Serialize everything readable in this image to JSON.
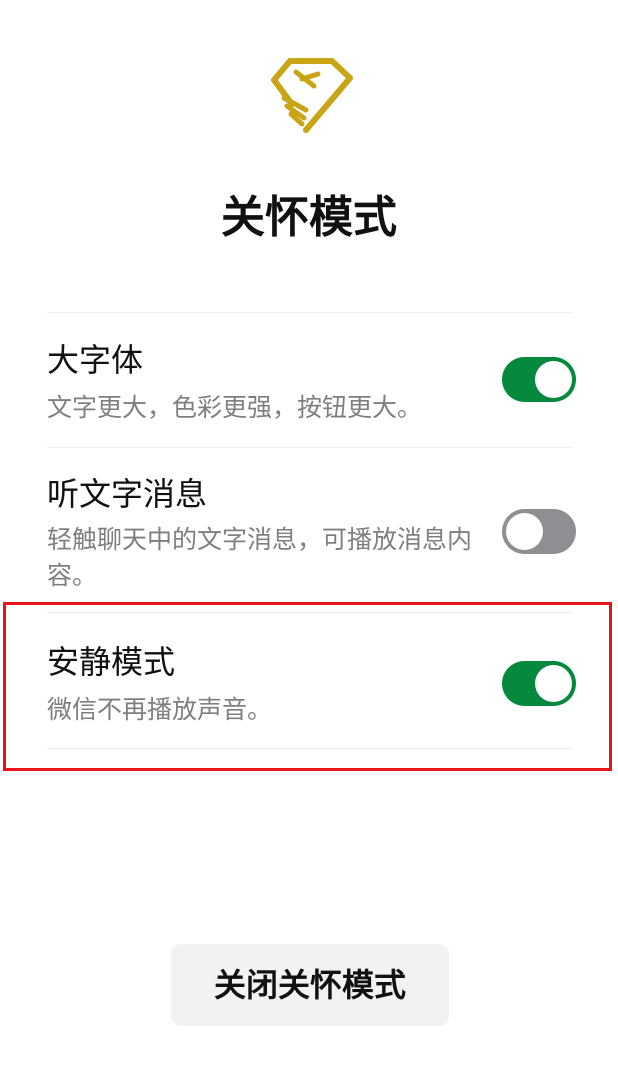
{
  "title": "关怀模式",
  "settings": [
    {
      "label": "大字体",
      "description": "文字更大，色彩更强，按钮更大。",
      "enabled": true
    },
    {
      "label": "听文字消息",
      "description": "轻触聊天中的文字消息，可播放消息内容。",
      "enabled": false
    },
    {
      "label": "安静模式",
      "description": "微信不再播放声音。",
      "enabled": true
    }
  ],
  "close_button_label": "关闭关怀模式",
  "colors": {
    "accent_green": "#07883f",
    "toggle_off": "#8e8e93",
    "logo_gold": "#c9a415",
    "highlight_red": "#e8141c"
  }
}
